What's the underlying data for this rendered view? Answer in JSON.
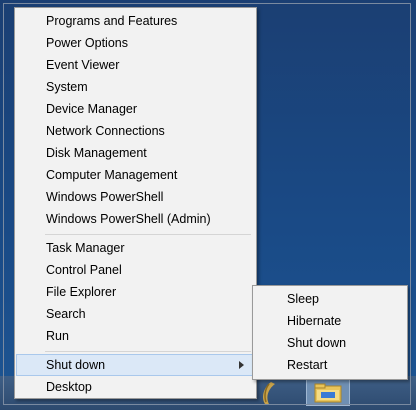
{
  "menu": {
    "items_group1": [
      "Programs and Features",
      "Power Options",
      "Event Viewer",
      "System",
      "Device Manager",
      "Network Connections",
      "Disk Management",
      "Computer Management",
      "Windows PowerShell",
      "Windows PowerShell (Admin)"
    ],
    "items_group2": [
      "Task Manager",
      "Control Panel",
      "File Explorer",
      "Search",
      "Run"
    ],
    "shut_down": "Shut down",
    "desktop": "Desktop"
  },
  "submenu": {
    "items": [
      "Sleep",
      "Hibernate",
      "Shut down",
      "Restart"
    ]
  },
  "taskbar": {
    "icons": [
      "folder-icon"
    ]
  },
  "colors": {
    "highlight": "#dbe8f7",
    "menu_bg": "#f2f2f2",
    "desktop_bg": "#1b4a84"
  }
}
